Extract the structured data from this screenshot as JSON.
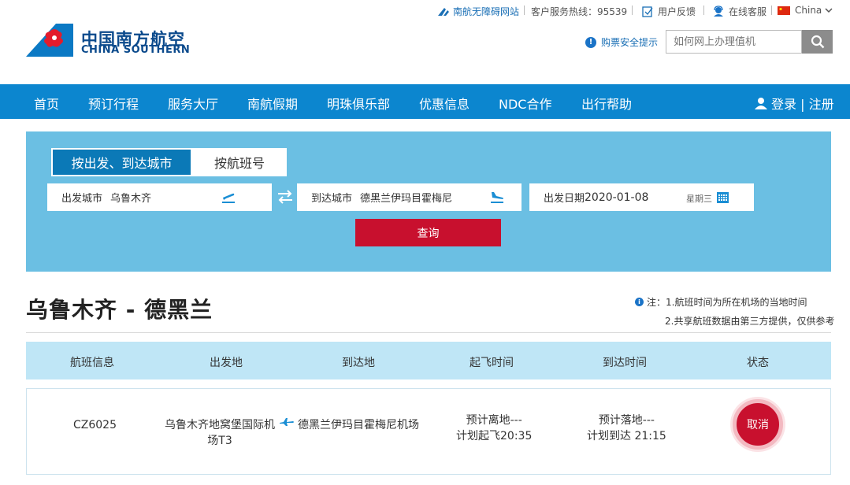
{
  "topbar": {
    "accessibility_label": "南航无障碍网站",
    "hotline_label": "客户服务热线：95539",
    "feedback_label": "用户反馈",
    "online_service_label": "在线客服",
    "region_label": "China"
  },
  "brand": {
    "name_cn": "中国南方航空",
    "name_en": "CHINA SOUTHERN"
  },
  "header": {
    "safety_tip": "购票安全提示",
    "search_placeholder": "如何网上办理值机"
  },
  "nav": {
    "items": [
      "首页",
      "预订行程",
      "服务大厅",
      "南航假期",
      "明珠俱乐部",
      "优惠信息",
      "NDC合作",
      "出行帮助"
    ],
    "login_label": "登录 | 注册"
  },
  "search_panel": {
    "tab_city": "按出发、到达城市",
    "tab_flight": "按航班号",
    "depart_label": "出发城市",
    "depart_value": "乌鲁木齐",
    "arrive_label": "到达城市",
    "arrive_value": "德黑兰伊玛目霍梅尼",
    "date_label": "出发日期",
    "date_value": "2020-01-08",
    "weekday": "星期三",
    "query_label": "查询"
  },
  "result": {
    "route_title": "乌鲁木齐 - 德黑兰",
    "note_1": "注：1.航班时间为所在机场的当地时间",
    "note_2": "2.共享航班数据由第三方提供，仅供参考"
  },
  "table": {
    "headers": [
      "航班信息",
      "出发地",
      "到达地",
      "起飞时间",
      "到达时间",
      "状态"
    ],
    "rows": [
      {
        "flight": "CZ6025",
        "origin_line1": "乌鲁木齐地窝堡国际机",
        "origin_line2": "场T3",
        "destination": "德黑兰伊玛目霍梅尼机场",
        "depart_line1": "预计离地---",
        "depart_line2": "计划起飞20:35",
        "arrive_line1": "预计落地---",
        "arrive_line2": "计划到达 21:15",
        "status": "取消"
      }
    ]
  },
  "colors": {
    "nav_blue": "#0c86cf",
    "panel_blue": "#6bbfe3",
    "brand_red": "#c8102e",
    "table_header": "#bfe6f6"
  }
}
